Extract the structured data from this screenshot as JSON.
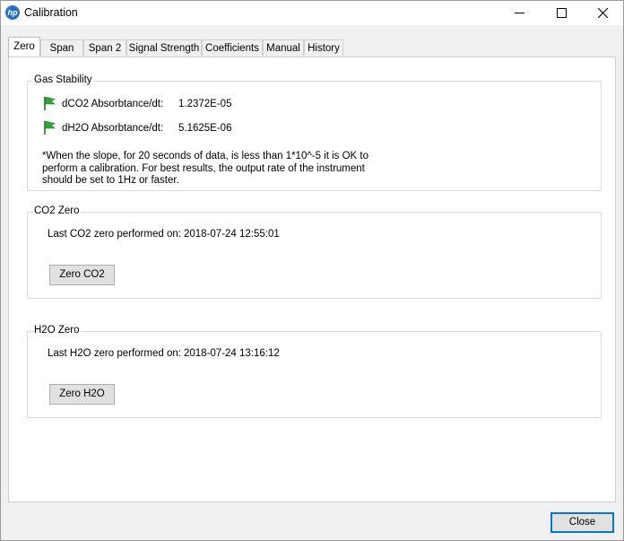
{
  "window": {
    "title": "Calibration",
    "icon": "hp-logo-icon"
  },
  "tabs": [
    "Zero",
    "Span",
    "Span 2",
    "Signal Strength",
    "Coefficients",
    "Manual",
    "History"
  ],
  "active_tab": "Zero",
  "gas_stability": {
    "title": "Gas Stability",
    "rows": [
      {
        "label": "dCO2 Absorbtance/dt:",
        "value": "1.2372E-05",
        "status": "green-flag"
      },
      {
        "label": "dH2O Absorbtance/dt:",
        "value": "5.1625E-06",
        "status": "green-flag"
      }
    ],
    "note_lines": [
      "*When the slope, for 20 seconds of data, is less than 1*10^-5 it is OK to",
      "perform a calibration.  For best results, the output rate of the instrument",
      "should be set to 1Hz or faster."
    ]
  },
  "co2_zero": {
    "title": "CO2 Zero",
    "last_label": "Last CO2 zero performed on:",
    "last_value": "2018-07-24 12:55:01",
    "button": "Zero CO2"
  },
  "h2o_zero": {
    "title": "H2O Zero",
    "last_label": "Last H2O zero performed on:",
    "last_value": "2018-07-24 13:16:12",
    "button": "Zero H2O"
  },
  "footer": {
    "close": "Close"
  },
  "colors": {
    "flag": "#2fa834",
    "accent": "#0078d7"
  }
}
